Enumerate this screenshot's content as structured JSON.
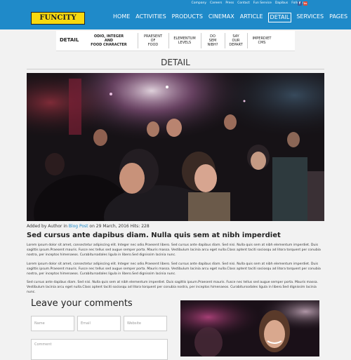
{
  "header": {
    "top_links": [
      "Company",
      "Careers",
      "Press",
      "Contact",
      "Fun Service",
      "Dapibus",
      "Follow us"
    ],
    "social": [
      {
        "icon": "facebook-icon",
        "glyph": "f"
      },
      {
        "icon": "linkedin-icon",
        "glyph": "in"
      }
    ],
    "logo": "FUNCITY",
    "nav": [
      "HOME",
      "ACTIVITIES",
      "PRODUCTS",
      "CINEMAX",
      "ARTICLE",
      "DETAIL",
      "SERVICES",
      "PAGES"
    ],
    "active_nav": "DETAIL",
    "colors": {
      "bar": "#1f8ac9",
      "logo": "#f8d90f"
    }
  },
  "subnav": {
    "title": "DETAIL",
    "items": [
      {
        "lines": [
          "ODIO, INTEGER",
          "AND",
          "FOOD CHARACTER"
        ],
        "bold": true
      },
      {
        "lines": [
          "PRAESENT",
          "OF",
          "FOOD"
        ],
        "bold": false
      },
      {
        "lines": [
          "ELEMENTUM",
          "LEVELS"
        ],
        "bold": false
      },
      {
        "lines": [
          "DO",
          "SEM",
          "NIBH?"
        ],
        "bold": false
      },
      {
        "lines": [
          "SAY",
          "OUR",
          "DEPART"
        ],
        "bold": false
      },
      {
        "lines": [
          "IMPERDIET",
          "CMS"
        ],
        "bold": false
      }
    ]
  },
  "page_title": "DETAIL",
  "article": {
    "meta_prefix": "Added by Author in ",
    "meta_link": "Blog Post",
    "meta_suffix": " on 29 March, 2016 Hits: 228",
    "headline": "Sed cursus ante dapibus diam. Nulla quis sem at nibh imperdiet",
    "paragraphs": [
      "Lorem ipsum dolor sit amet, consectetur adipiscing elit. Integer nec odio.Praesent libero. Sed cursus ante dapibus diam. Sed nisi. Nulla quis sem at nibh elementum imperdiet. Duis sagittis ipsum.Praesent mauris. Fusce nec tellus sed augue semper porta. Mauris massa. Vestibulum lacinia arcu eget nulla.Class aptent taciti sociosqu ad litora torquent per conubia nostra, per inceptos himenaeos. Curabitursodales ligula in libero.Sed dignissim lacinia nunc.",
      "Lorem ipsum dolor sit amet, consectetur adipiscing elit. Integer nec odio.Praesent libero. Sed cursus ante dapibus diam. Sed nisi. Nulla quis sem at nibh elementum imperdiet. Duis sagittis ipsum.Praesent mauris. Fusce nec tellus sed augue semper porta. Mauris massa. Vestibulum lacinia arcu eget nulla.Class aptent taciti sociosqu ad litora torquent per conubia nostra, per inceptos himenaeos. Curabitursodales ligula in libero.Sed dignissim lacinia nunc.",
      "Sed cursus ante dapibus diam. Sed nisi. Nulla quis sem at nibh elementum imperdiet. Duis sagittis ipsum.Praesent mauris. Fusce nec tellus sed augue semper porta. Mauris massa. Vestibulum lacinia arcu eget nulla.Class aptent taciti sociosqu ad litora torquent per conubia nostra, per inceptos himenaeos. Curabitursodales ligula in libero.Sed dignissim lacinia nunc."
    ]
  },
  "comments": {
    "heading": "Leave your comments",
    "name_placeholder": "Name",
    "email_placeholder": "Email",
    "website_placeholder": "Website",
    "comment_placeholder": "Comment"
  }
}
